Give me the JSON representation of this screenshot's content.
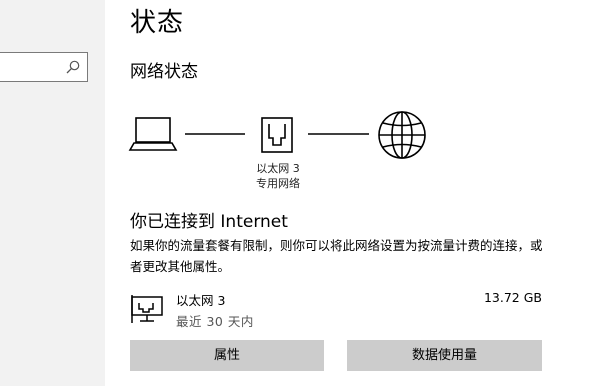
{
  "page": {
    "title": "状态"
  },
  "search": {
    "placeholder": ""
  },
  "network_status": {
    "heading": "网络状态",
    "adapter_label_line1": "以太网 3",
    "adapter_label_line2": "专用网络",
    "connected_text": "你已连接到 Internet",
    "description": "如果你的流量套餐有限制，则你可以将此网络设置为按流量计费的连接，或者更改其他属性。"
  },
  "connection": {
    "name": "以太网 3",
    "period": "最近 30 天内",
    "data_used": "13.72 GB"
  },
  "buttons": {
    "properties": "属性",
    "data_usage": "数据使用量"
  },
  "icons": {
    "laptop": "laptop-icon",
    "ethernet_port": "ethernet-port-icon",
    "globe": "globe-icon",
    "search": "search-icon",
    "ethernet_adapter": "ethernet-adapter-icon"
  },
  "colors": {
    "sidebar_bg": "#f2f2f2",
    "button_bg": "#cccccc"
  }
}
